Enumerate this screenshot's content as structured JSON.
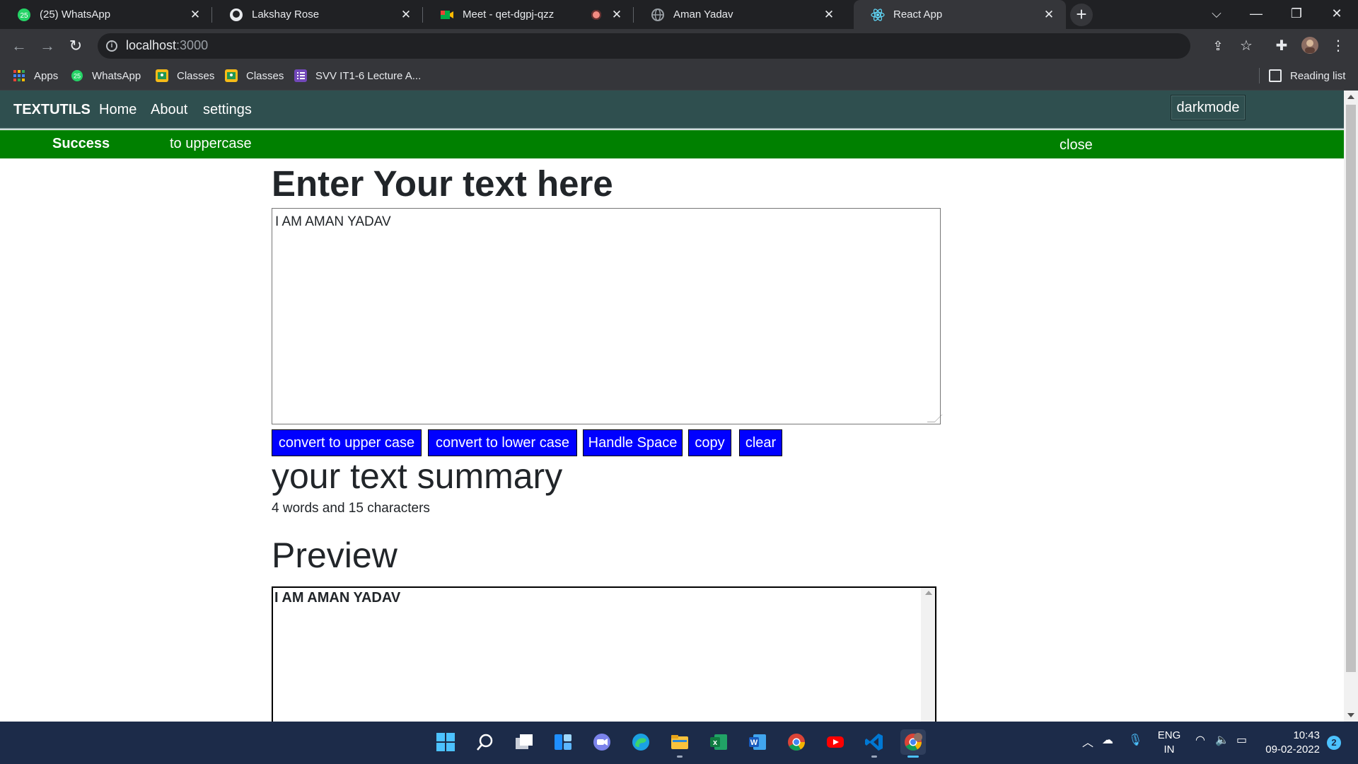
{
  "browser": {
    "tabs": [
      {
        "title": "(25) WhatsApp",
        "icon": "whatsapp-icon"
      },
      {
        "title": "Lakshay Rose",
        "icon": "github-icon"
      },
      {
        "title": "Meet - qet-dgpj-qzz",
        "icon": "google-meet-icon"
      },
      {
        "title": "Aman Yadav",
        "icon": "globe-icon"
      },
      {
        "title": "React App",
        "icon": "react-icon"
      }
    ],
    "url_host": "localhost",
    "url_port": ":3000",
    "bookmarks": [
      {
        "label": "Apps",
        "icon": "apps-grid-icon"
      },
      {
        "label": "WhatsApp",
        "icon": "whatsapp-icon"
      },
      {
        "label": "Classes",
        "icon": "google-classroom-icon"
      },
      {
        "label": "Classes",
        "icon": "google-classroom-icon"
      },
      {
        "label": "SVV IT1-6 Lecture A...",
        "icon": "list-icon"
      }
    ],
    "reading_list": "Reading list",
    "whatsapp_badge": "25"
  },
  "app": {
    "brand": "TEXTUTILS",
    "nav": [
      "Home",
      "About",
      "settings"
    ],
    "darkmode_label": "darkmode",
    "alert": {
      "strong": "Success",
      "message": "to uppercase",
      "close": "close",
      "color": "#008000"
    },
    "heading": "Enter Your text here",
    "textarea_value": "I AM AMAN YADAV",
    "buttons": [
      "convert to upper case",
      "convert to lower case",
      "Handle Space",
      "copy",
      "clear"
    ],
    "summary_heading": "your text summary",
    "summary_text": "4 words and 15 characters",
    "preview_heading": "Preview",
    "preview_text": "I AM AMAN YADAV",
    "colors": {
      "navbar": "#2f4f4f",
      "button": "#0000ff"
    }
  },
  "taskbar": {
    "apps": [
      "windows-start-icon",
      "search-icon",
      "task-view-icon",
      "widgets-icon",
      "teams-chat-icon",
      "edge-icon",
      "file-explorer-icon",
      "excel-icon",
      "word-icon",
      "chrome-icon",
      "youtube-icon",
      "vscode-icon",
      "chrome-profile-icon"
    ],
    "lang_top": "ENG",
    "lang_bottom": "IN",
    "time": "10:43",
    "date": "09-02-2022",
    "notifications": "2"
  }
}
